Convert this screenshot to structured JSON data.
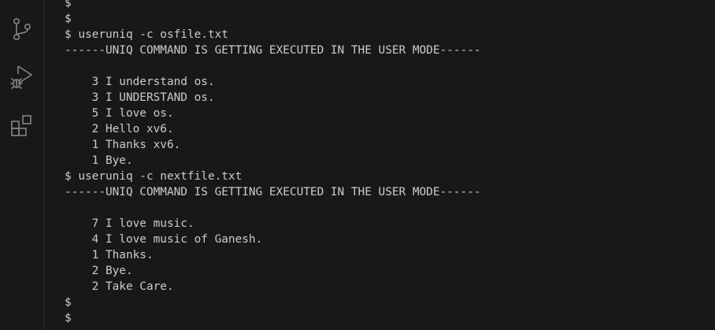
{
  "activity_bar": {
    "items": [
      {
        "name": "source-control-icon"
      },
      {
        "name": "run-and-debug-icon"
      },
      {
        "name": "extensions-icon"
      }
    ]
  },
  "terminal": {
    "lines": [
      "$",
      "$",
      "$ useruniq -c osfile.txt",
      "------UNIQ COMMAND IS GETTING EXECUTED IN THE USER MODE------",
      "",
      "    3 I understand os.",
      "    3 I UNDERSTAND os.",
      "    5 I love os.",
      "    2 Hello xv6.",
      "    1 Thanks xv6.",
      "    1 Bye.",
      "$ useruniq -c nextfile.txt",
      "------UNIQ COMMAND IS GETTING EXECUTED IN THE USER MODE------",
      "",
      "    7 I love music.",
      "    4 I love music of Ganesh.",
      "    1 Thanks.",
      "    2 Bye.",
      "    2 Take Care.",
      "$",
      "$"
    ]
  },
  "colors": {
    "background": "#181818",
    "text": "#cccccc",
    "icon": "#858585"
  }
}
